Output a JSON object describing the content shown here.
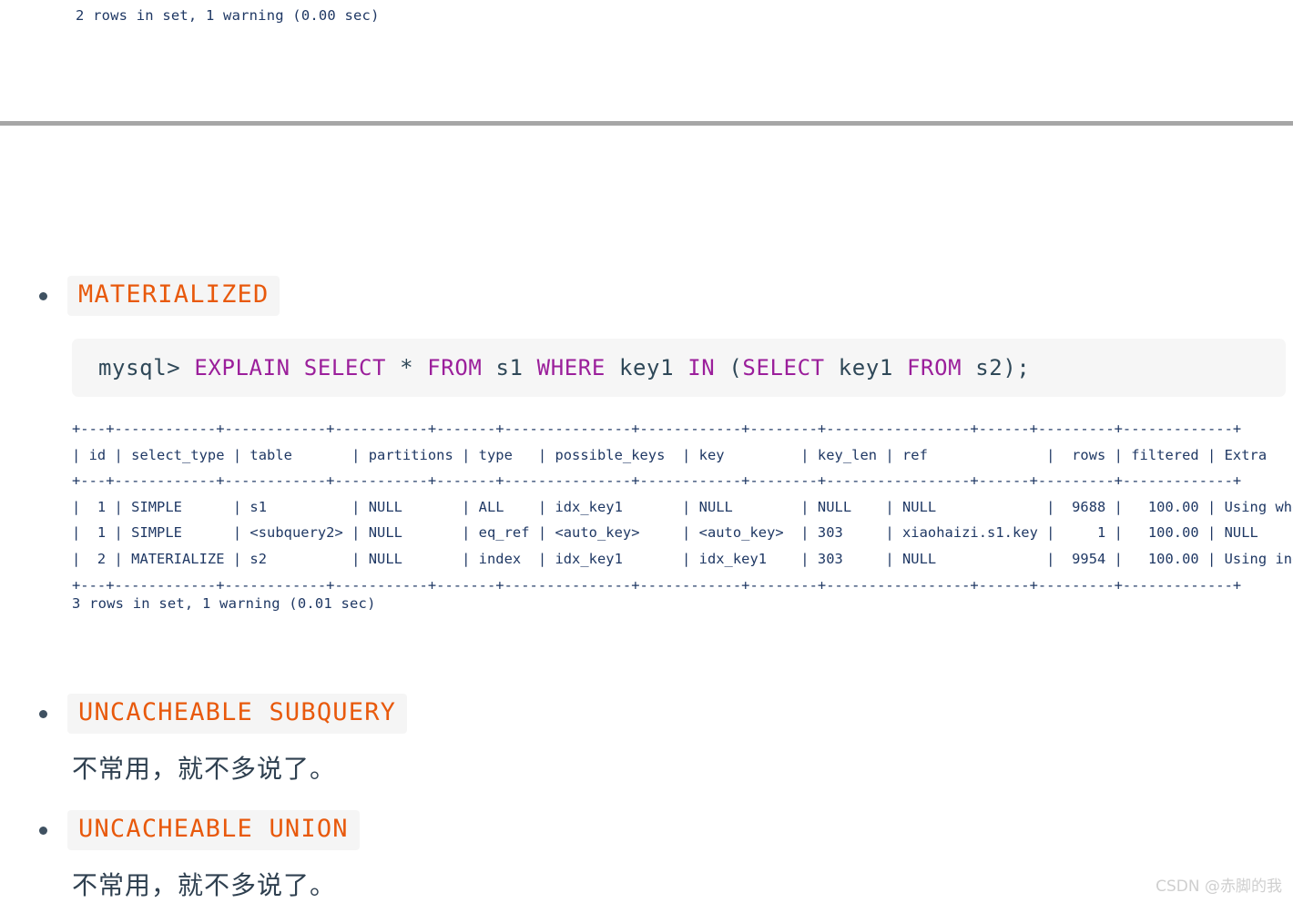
{
  "top_result": "2 rows in set, 1 warning (0.00 sec)",
  "sections": [
    {
      "badge": "MATERIALIZED",
      "note": ""
    },
    {
      "badge": "UNCACHEABLE SUBQUERY",
      "note": "不常用，就不多说了。"
    },
    {
      "badge": "UNCACHEABLE UNION",
      "note": "不常用，就不多说了。"
    }
  ],
  "sql": {
    "prompt": "mysql> ",
    "tokens": [
      {
        "t": "EXPLAIN",
        "kw": true
      },
      {
        "t": " ",
        "kw": false
      },
      {
        "t": "SELECT",
        "kw": true
      },
      {
        "t": " * ",
        "kw": false
      },
      {
        "t": "FROM",
        "kw": true
      },
      {
        "t": " s1 ",
        "kw": false
      },
      {
        "t": "WHERE",
        "kw": true
      },
      {
        "t": " key1 ",
        "kw": false
      },
      {
        "t": "IN",
        "kw": true
      },
      {
        "t": " (",
        "kw": false
      },
      {
        "t": "SELECT",
        "kw": true
      },
      {
        "t": " key1 ",
        "kw": false
      },
      {
        "t": "FROM",
        "kw": true
      },
      {
        "t": " s2);",
        "kw": false
      }
    ],
    "full_text": "mysql> EXPLAIN SELECT * FROM s1 WHERE key1 IN (SELECT key1 FROM s2);"
  },
  "explain": {
    "columns": [
      "id",
      "select_type",
      "table",
      "partitions",
      "type",
      "possible_keys",
      "key",
      "key_len",
      "ref",
      "rows",
      "filtered",
      "Extra"
    ],
    "widths": [
      4,
      13,
      13,
      12,
      8,
      16,
      13,
      9,
      18,
      7,
      10,
      14
    ],
    "align_right": [
      true,
      false,
      false,
      false,
      false,
      false,
      false,
      false,
      false,
      true,
      true,
      false
    ],
    "rows": [
      [
        "1",
        "SIMPLE",
        "s1",
        "NULL",
        "ALL",
        "idx_key1",
        "NULL",
        "NULL",
        "NULL",
        "9688",
        "100.00",
        "Using where"
      ],
      [
        "1",
        "SIMPLE",
        "<subquery2>",
        "NULL",
        "eq_ref",
        "<auto_key>",
        "<auto_key>",
        "303",
        "xiaohaizi.s1.key1",
        "1",
        "100.00",
        "NULL"
      ],
      [
        "2",
        "MATERIALIZED",
        "s2",
        "NULL",
        "index",
        "idx_key1",
        "idx_key1",
        "303",
        "NULL",
        "9954",
        "100.00",
        "Using index"
      ]
    ]
  },
  "bottom_result": "3 rows in set, 1 warning (0.01 sec)",
  "watermark": "CSDN @赤脚的我",
  "colors": {
    "badge_text": "#e8590c",
    "badge_bg": "#f5f5f5",
    "sql_keyword": "#9b1f9b",
    "console_text": "#1f3864",
    "divider": "#a6a6a6"
  }
}
